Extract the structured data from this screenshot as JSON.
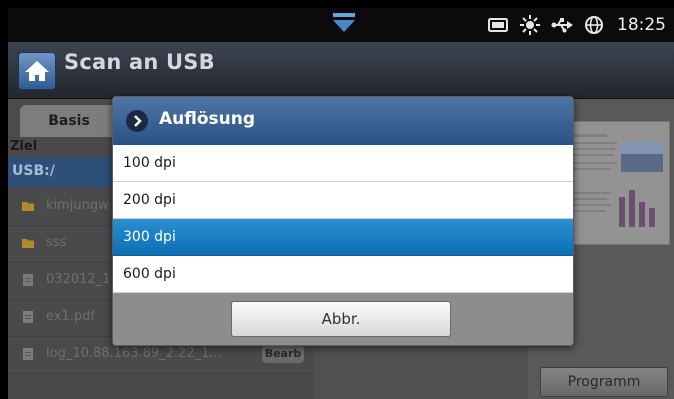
{
  "status": {
    "time": "18:25"
  },
  "header": {
    "title": "Scan an USB"
  },
  "tabs": {
    "basis": "Basis"
  },
  "left": {
    "ziel": "Ziel",
    "path": "USB:/",
    "files": [
      {
        "name": "kimjungw",
        "icon": "folder-icon"
      },
      {
        "name": "sss",
        "icon": "folder-icon"
      },
      {
        "name": "032012_1",
        "icon": "file-icon"
      },
      {
        "name": "ex1.pdf",
        "icon": "file-icon"
      },
      {
        "name": "log_10.88.163.89_2.22_1...",
        "icon": "file-icon"
      }
    ],
    "bearb": "Bearb"
  },
  "right": {
    "programm": "Programm"
  },
  "dialog": {
    "title": "Auflösung",
    "options": [
      "100 dpi",
      "200 dpi",
      "300 dpi",
      "600 dpi"
    ],
    "selected": "300 dpi",
    "cancel": "Abbr."
  },
  "colors": {
    "selected": "#0d6eb4",
    "dialog_header": "#2d5183",
    "folder": "#b08a2e"
  }
}
